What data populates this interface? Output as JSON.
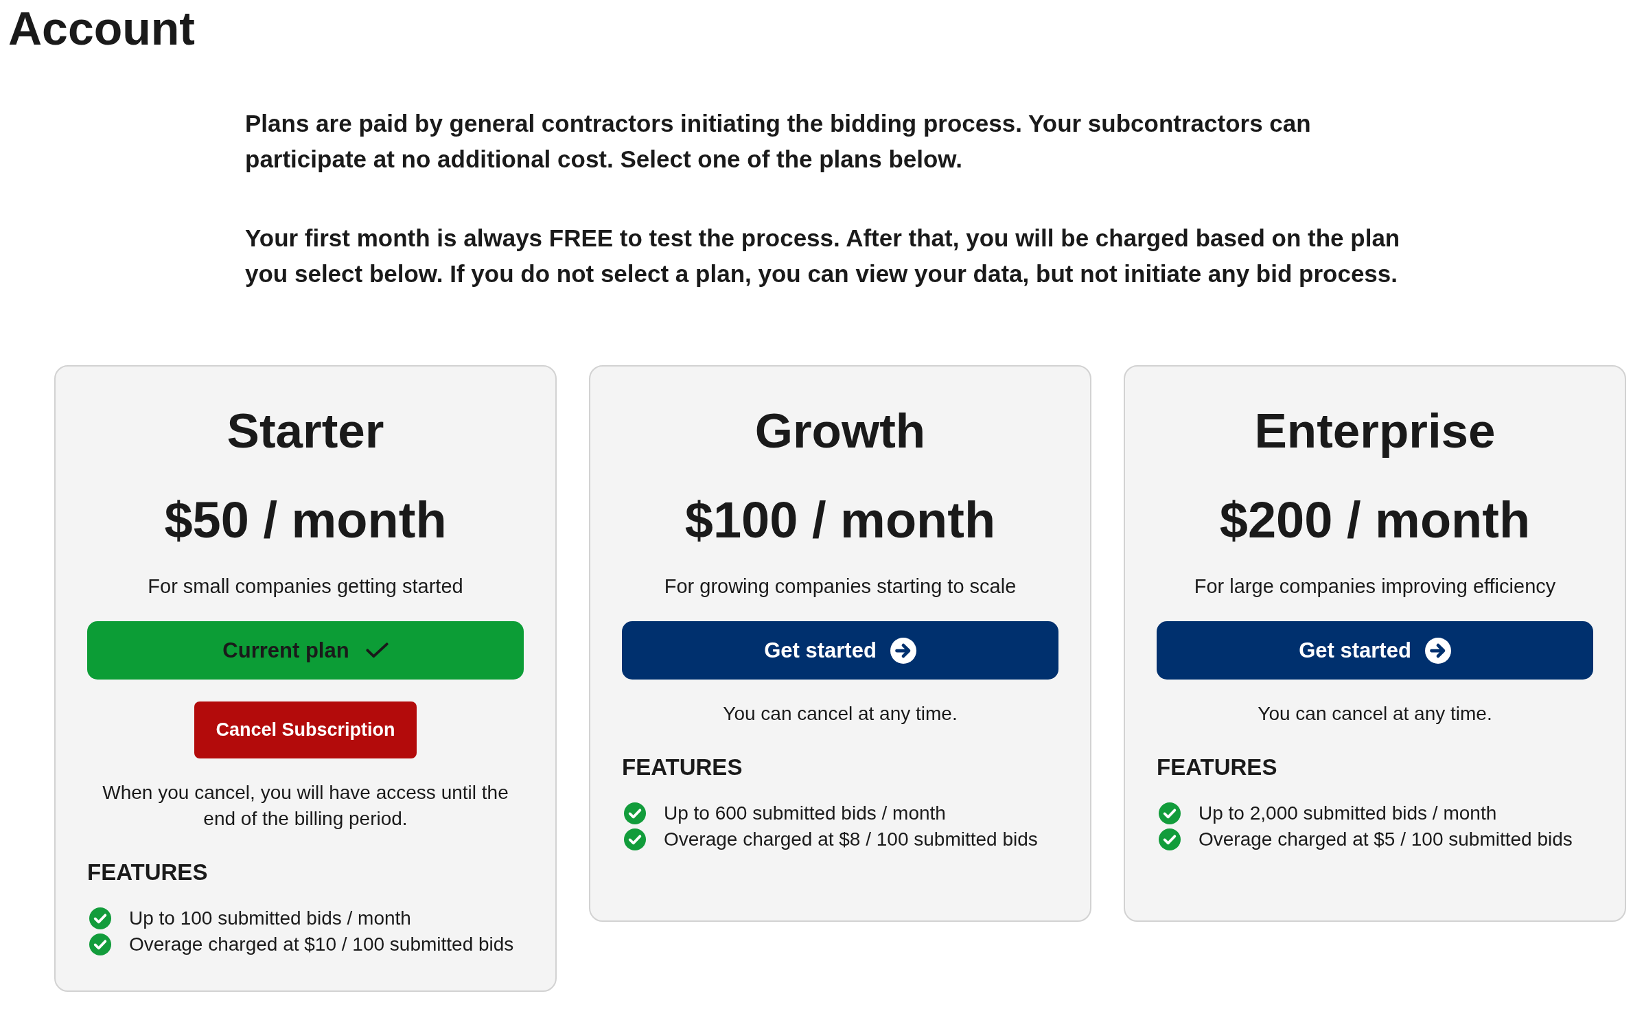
{
  "page": {
    "title": "Account"
  },
  "intro": [
    "Plans are paid by general contractors initiating the bidding process. Your subcontractors can participate at no additional cost. Select one of the plans below.",
    "Your first month is always FREE to test the process. After that, you will be charged based on the plan you select below. If you do not select a plan, you can view your data, but not initiate any bid process."
  ],
  "plans": [
    {
      "name": "Starter",
      "price": "$50 / month",
      "tagline": "For small companies getting started",
      "current": true,
      "button": "Current plan",
      "cancel_button": "Cancel Subscription",
      "note": "When you cancel, you will have access until the end of the billing period.",
      "features_heading": "FEATURES",
      "features": [
        "Up to 100 submitted bids / month",
        "Overage charged at $10 / 100 submitted bids"
      ]
    },
    {
      "name": "Growth",
      "price": "$100 / month",
      "tagline": "For growing companies starting to scale",
      "current": false,
      "button": "Get started",
      "note": "You can cancel at any time.",
      "features_heading": "FEATURES",
      "features": [
        "Up to 600 submitted bids / month",
        "Overage charged at $8 / 100 submitted bids"
      ]
    },
    {
      "name": "Enterprise",
      "price": "$200 / month",
      "tagline": "For large companies improving efficiency",
      "current": false,
      "button": "Get started",
      "note": "You can cancel at any time.",
      "features_heading": "FEATURES",
      "features": [
        "Up to 2,000 submitted bids / month",
        "Overage charged at $5 / 100 submitted bids"
      ]
    }
  ]
}
